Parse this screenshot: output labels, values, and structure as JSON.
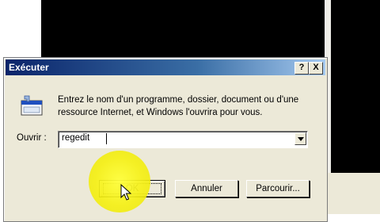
{
  "dialog": {
    "title": "Exécuter",
    "help_label": "?",
    "close_label": "X",
    "description_line1": "Entrez le nom d'un programme, dossier, document ou d'une",
    "description_line2": "ressource Internet, et Windows l'ouvrira pour vous.",
    "open_label": "Ouvrir :",
    "open_value": "regedit",
    "buttons": {
      "ok": "OK",
      "cancel": "Annuler",
      "browse": "Parcourir..."
    }
  },
  "icons": {
    "run": "run-program-icon",
    "dropdown": "chevron-down-icon",
    "pointer": "mouse-pointer-icon"
  },
  "colors": {
    "titlebar_start": "#0a246a",
    "titlebar_end": "#a6caf0",
    "dialog_bg": "#ece9d8",
    "highlight": "#f5f014"
  }
}
